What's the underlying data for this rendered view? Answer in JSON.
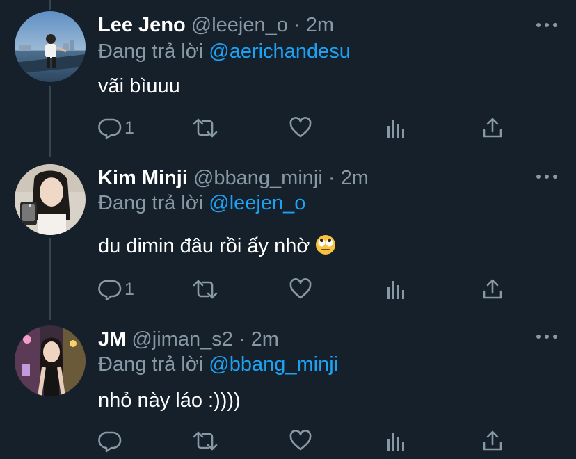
{
  "tweets": [
    {
      "name": "Lee Jeno",
      "handle": "@leejen_o",
      "dot": "·",
      "time": "2m",
      "replying_prefix": "Đang trả lời",
      "replying_to": "@aerichandesu",
      "text": "vãi bìuuu",
      "reply_count": "1",
      "avatar_icon": "avatar-photo-icon"
    },
    {
      "name": "Kim Minji",
      "handle": "@bbang_minji",
      "dot": "·",
      "time": "2m",
      "replying_prefix": "Đang trả lời",
      "replying_to": "@leejen_o",
      "text": "du dimin đâu rồi ấy nhờ",
      "emoji": "face-with-rolling-eyes-icon",
      "reply_count": "1",
      "avatar_icon": "avatar-photo-icon"
    },
    {
      "name": "JM",
      "handle": "@jiman_s2",
      "dot": "·",
      "time": "2m",
      "replying_prefix": "Đang trả lời",
      "replying_to": "@bbang_minji",
      "text": "nhỏ này láo :))))",
      "reply_count": "",
      "avatar_icon": "avatar-photo-icon"
    }
  ],
  "icons": [
    "reply-icon",
    "retweet-icon",
    "like-icon",
    "analytics-icon",
    "share-icon",
    "more-icon"
  ],
  "colors": {
    "background": "#15202b",
    "secondary_text": "#8899a6",
    "accent": "#1da1f2",
    "thread_line": "#38444d"
  }
}
